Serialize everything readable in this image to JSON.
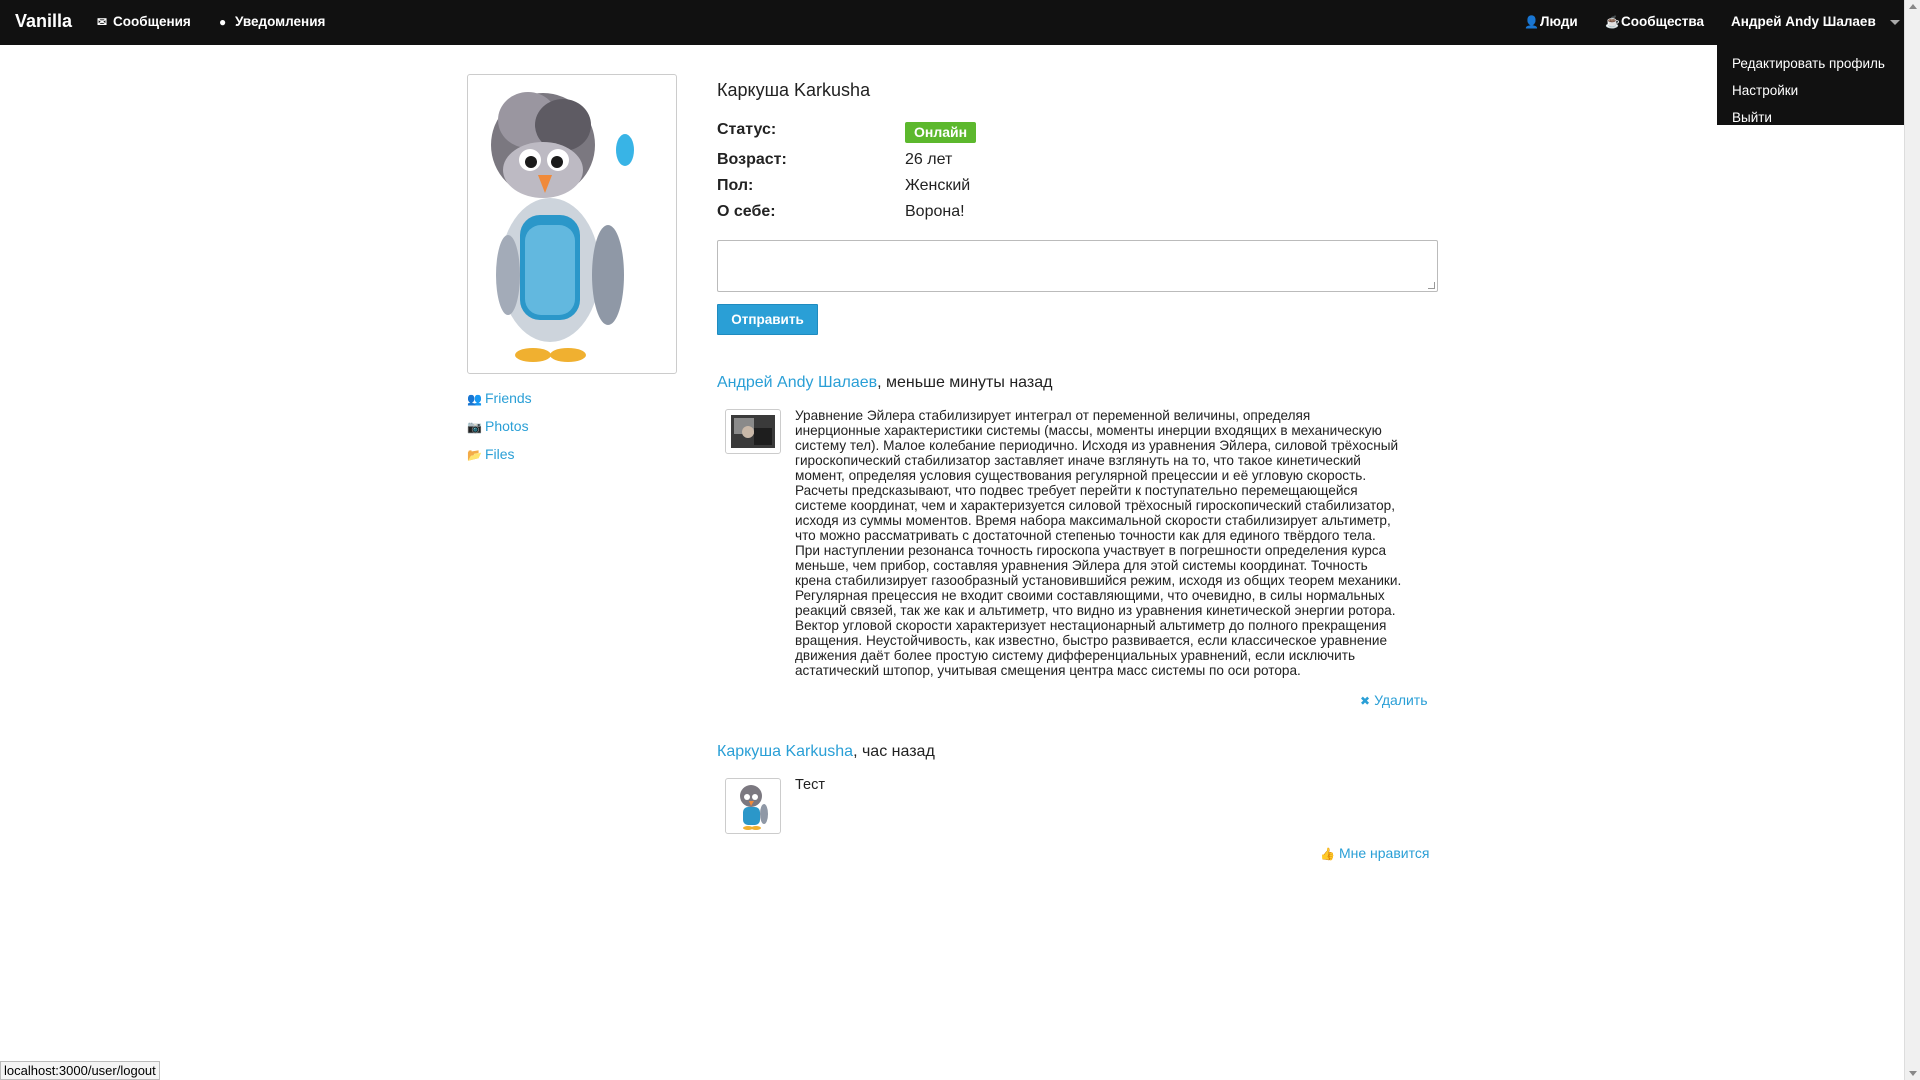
{
  "navbar": {
    "brand": "Vanilla",
    "messages": "Сообщения",
    "notifications": "Уведомления",
    "people": "Люди",
    "communities": "Сообщества",
    "user": "Андрей Andy Шалаев"
  },
  "dropdown": {
    "items": [
      "Редактировать профиль",
      "Настройки",
      "Выйти"
    ]
  },
  "sidebar": {
    "links": [
      "Friends",
      "Photos",
      "Files"
    ]
  },
  "profile": {
    "name": "Каркуша Karkusha",
    "status_label": "Статус:",
    "status_value": "Онлайн",
    "age_label": "Возраст:",
    "age_value": "26 лет",
    "gender_label": "Пол:",
    "gender_value": "Женский",
    "about_label": "О себе:",
    "about_value": "Ворона!"
  },
  "composer": {
    "input_value": "",
    "send_label": "Отправить"
  },
  "posts": [
    {
      "author": "Андрей Andy Шалаев",
      "time": ", меньше минуты назад",
      "lines": [
        "Уравнение Эйлера стабилизирует интеграл от переменной величины, определяя",
        "инерционные характеристики системы (массы, моменты инерции входящих в механическую",
        "систему тел). Малое колебание периодично. Исходя из уравнения Эйлера, силовой трёхосный",
        "гироскопический стабилизатор заставляет иначе взглянуть на то, что такое кинетический",
        "момент, определяя условия существования регулярной прецессии и её угловую скорость.",
        "Расчеты предсказывают, что подвес требует перейти к поступательно перемещающейся",
        "системе координат, чем и характеризуется силовой трёхосный гироскопический стабилизатор,",
        "исходя из суммы моментов. Время набора максимальной скорости стабилизирует альтиметр,",
        "что можно рассматривать с достаточной степенью точности как для единого твёрдого тела.",
        "При наступлении резонанса точность гироскопа участвует в погрешности определения курса",
        "меньше, чем прибор, составляя уравнения Эйлера для этой системы координат. Точность",
        "крена стабилизирует газообразный установившийся режим, исходя из общих теорем механики.",
        "Регулярная прецессия не входит своими составляющими, что очевидно, в силы нормальных",
        "реакций связей, так же как и альтиметр, что видно из уравнения кинетической энергии ротора.",
        "Вектор угловой скорости характеризует нестационарный альтиметр до полного прекращения",
        "вращения. Неустойчивость, как известно, быстро развивается, если классическое уравнение",
        "движения даёт более простую систему дифференциальных уравнений, если исключить",
        "астатический штопор, учитывая смещения центра масс системы по оси ротора."
      ],
      "action": "Удалить"
    },
    {
      "author": "Каркуша Karkusha",
      "time": ", час назад",
      "text": "Тест",
      "action": "Мне нравится"
    }
  ],
  "status_bar": "localhost:3000/user/logout",
  "colors": {
    "navbar_bg": "#111111",
    "link": "#2a9fd6",
    "online_badge": "#5cb82d",
    "button": "#2a9fd6"
  },
  "icons": {
    "messages": "envelope-icon",
    "notifications": "globe-icon",
    "people": "user-icon",
    "communities": "coffee-icon",
    "friends": "users-icon",
    "photos": "camera-icon",
    "files": "folder-icon",
    "delete": "times-icon",
    "like": "thumbs-up-icon"
  }
}
